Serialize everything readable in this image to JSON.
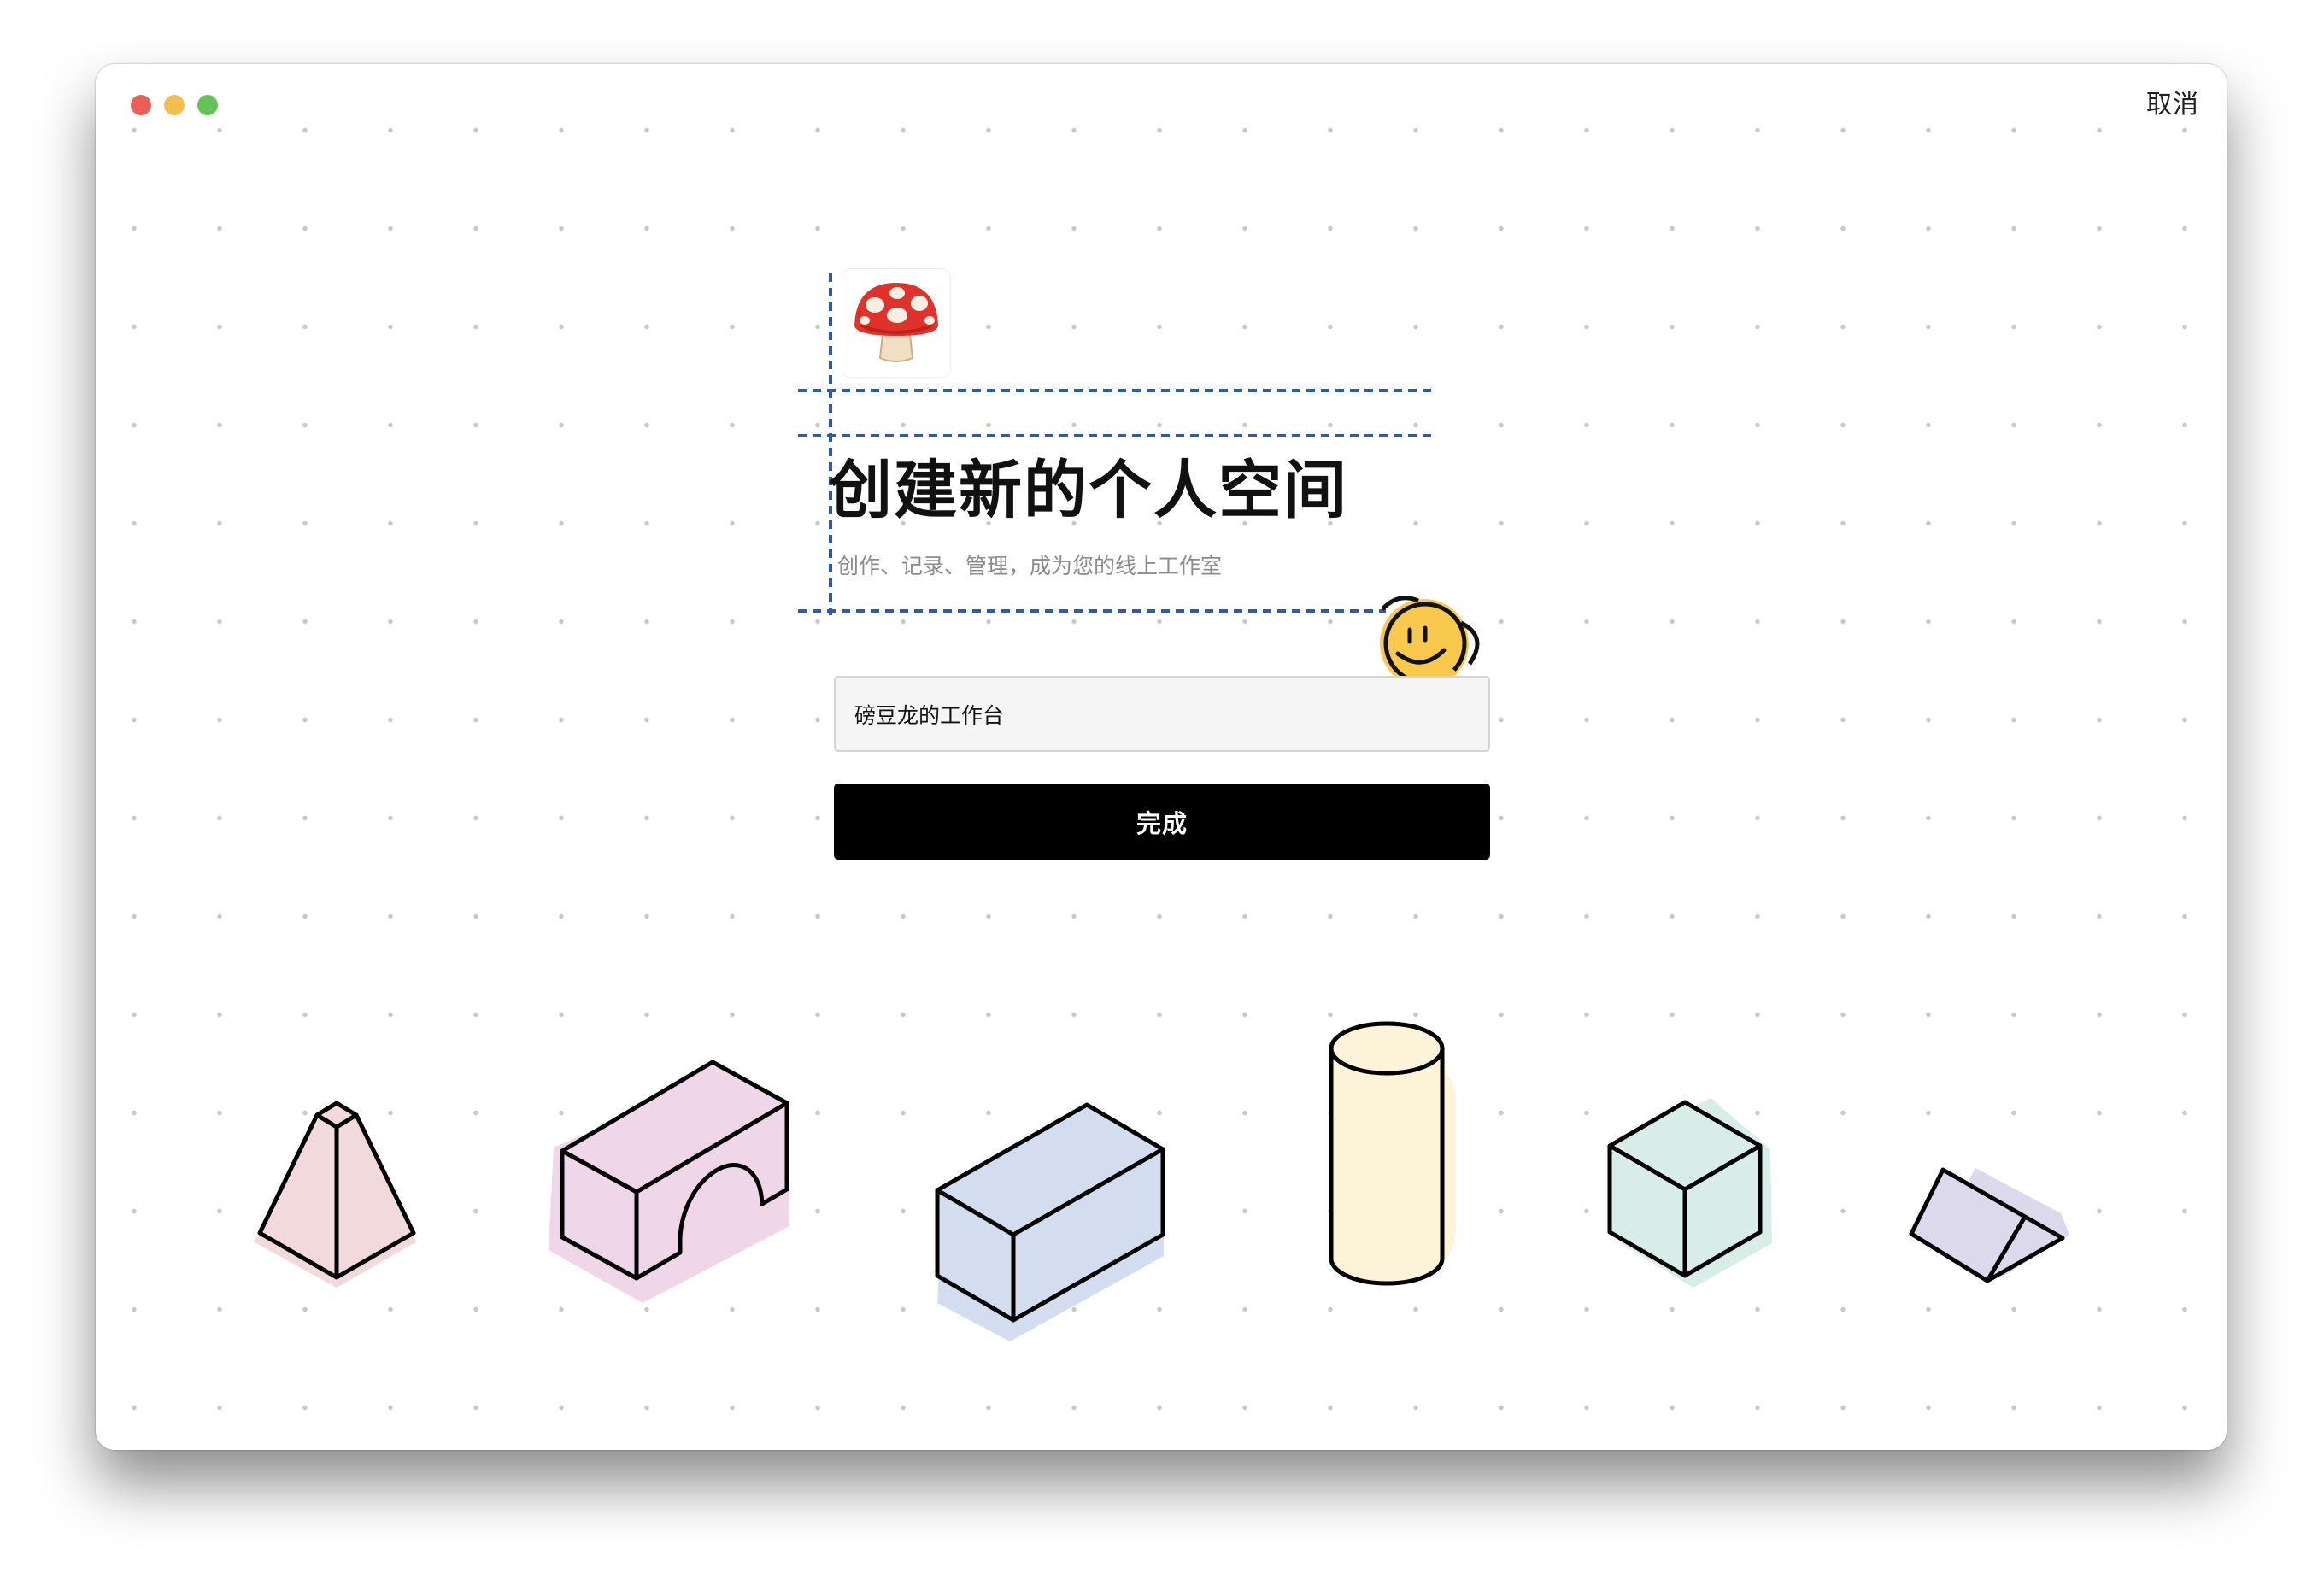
{
  "window": {
    "close_label": "",
    "cancel_label": "取消"
  },
  "header": {
    "emoji": "mushroom",
    "title": "创建新的个人空间",
    "subtitle": "创作、记录、管理，成为您的线上工作室"
  },
  "form": {
    "name_value": "磅豆龙的工作台",
    "submit_label": "完成"
  },
  "decoration": {
    "mascot": "smiley-face-icon",
    "shapes": [
      "pyramid",
      "arch-block",
      "rectangular-block",
      "cylinder",
      "cube",
      "triangular-prism"
    ]
  },
  "colors": {
    "button": "#000000",
    "guide": "#2f5aa8",
    "pyramid": "#f2d9dc",
    "arch": "#efd6e8",
    "block": "#d4dcef",
    "cylinder": "#fdf3d8",
    "cube": "#d9ede8",
    "prism": "#ddd9ec"
  }
}
